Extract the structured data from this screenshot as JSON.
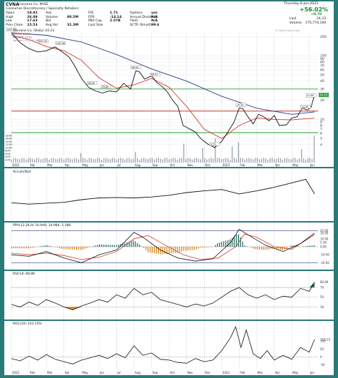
{
  "header": {
    "ticker": "CVNA",
    "company": "Carvana Co. NYSE",
    "sector": "Consumer Discretionary / Specialty Retailers",
    "stats": [
      {
        "label": "Open",
        "value": "18.82"
      },
      {
        "label": "High",
        "value": "26.09"
      },
      {
        "label": "Low",
        "value": "17.63"
      },
      {
        "label": "Prev Close",
        "value": "15.53"
      },
      {
        "label": "Ask",
        "value": ""
      },
      {
        "label": "Volume",
        "value": "80.5M"
      },
      {
        "label": "Bid",
        "value": ""
      },
      {
        "label": "Avg Vol",
        "value": "31.3M"
      },
      {
        "label": "P/E",
        "value": "1.71"
      },
      {
        "label": "EPS",
        "value": "-14.14"
      },
      {
        "label": "Mkt Cap",
        "value": "2.57B"
      },
      {
        "label": "Last Size",
        "value": ""
      },
      {
        "label": "Options",
        "value": "yes"
      },
      {
        "label": "Annual Dividend",
        "value": "N/A"
      },
      {
        "label": "Yield",
        "value": "N/A"
      },
      {
        "label": "SCTR (Small)",
        "value": "99.6"
      }
    ],
    "date": "Thursday 8-Jun-2023",
    "pct_change": "+56.02%",
    "change": "+8.70",
    "last_label": "Last",
    "last": "24.23",
    "volume_label": "Volume",
    "volume_total": "175,774,160",
    "watermark": "© StockCharts.com"
  },
  "chart_data": [
    {
      "type": "line",
      "title": "Carvana Co. (Daily) 24.23",
      "legend": [
        "MA(50) 10.47",
        "MA(200) 13.11",
        "Volume 175,774,160"
      ],
      "x_ticks": [
        "2022",
        "Feb",
        "Mar",
        "Apr",
        "May",
        "Jun",
        "Jul",
        "Aug",
        "Sep",
        "Oct",
        "Nov",
        "Dec",
        "2023",
        "Feb",
        "Mar",
        "Apr",
        "May",
        "Jun"
      ],
      "y_ticks": [
        4,
        5,
        6,
        7,
        8,
        9,
        10,
        20,
        30,
        40,
        50,
        60,
        70,
        80,
        90,
        100,
        200
      ],
      "ylim": [
        3.5,
        230
      ],
      "log_scale": true,
      "price": [
        {
          "m": 0.0,
          "v": 230
        },
        {
          "m": 0.5,
          "v": 160
        },
        {
          "m": 1.0,
          "v": 130
        },
        {
          "m": 1.5,
          "v": 115
        },
        {
          "m": 2.0,
          "v": 120
        },
        {
          "m": 2.5,
          "v": 138
        },
        {
          "m": 3.0,
          "v": 110
        },
        {
          "m": 3.3,
          "v": 95
        },
        {
          "m": 3.6,
          "v": 70
        },
        {
          "m": 4.0,
          "v": 44
        },
        {
          "m": 4.4,
          "v": 32
        },
        {
          "m": 4.8,
          "v": 28
        },
        {
          "m": 5.2,
          "v": 26
        },
        {
          "m": 5.6,
          "v": 28
        },
        {
          "m": 6.0,
          "v": 27
        },
        {
          "m": 6.4,
          "v": 37
        },
        {
          "m": 6.8,
          "v": 30
        },
        {
          "m": 7.1,
          "v": 58
        },
        {
          "m": 7.3,
          "v": 56
        },
        {
          "m": 7.6,
          "v": 43
        },
        {
          "m": 8.0,
          "v": 48
        },
        {
          "m": 8.3,
          "v": 38
        },
        {
          "m": 8.6,
          "v": 33
        },
        {
          "m": 8.9,
          "v": 27
        },
        {
          "m": 9.2,
          "v": 20
        },
        {
          "m": 9.5,
          "v": 16
        },
        {
          "m": 9.8,
          "v": 8
        },
        {
          "m": 10.2,
          "v": 7
        },
        {
          "m": 10.5,
          "v": 6.3
        },
        {
          "m": 10.8,
          "v": 5
        },
        {
          "m": 11.2,
          "v": 4.1
        },
        {
          "m": 11.6,
          "v": 3.6
        },
        {
          "m": 12.0,
          "v": 4.5
        },
        {
          "m": 12.3,
          "v": 6
        },
        {
          "m": 12.7,
          "v": 9
        },
        {
          "m": 13.0,
          "v": 15
        },
        {
          "m": 13.2,
          "v": 14.8
        },
        {
          "m": 13.5,
          "v": 11
        },
        {
          "m": 13.8,
          "v": 8.5
        },
        {
          "m": 14.1,
          "v": 12
        },
        {
          "m": 14.4,
          "v": 11
        },
        {
          "m": 14.7,
          "v": 9.5
        },
        {
          "m": 15.0,
          "v": 11.5
        },
        {
          "m": 15.3,
          "v": 8
        },
        {
          "m": 15.7,
          "v": 8.2
        },
        {
          "m": 16.0,
          "v": 10.5
        },
        {
          "m": 16.3,
          "v": 11
        },
        {
          "m": 16.6,
          "v": 15
        },
        {
          "m": 16.9,
          "v": 14
        },
        {
          "m": 17.1,
          "v": 15.5
        },
        {
          "m": 17.3,
          "v": 24.23
        }
      ],
      "ma50": [
        {
          "m": 0.0,
          "v": 210
        },
        {
          "m": 1.0,
          "v": 180
        },
        {
          "m": 2.0,
          "v": 140
        },
        {
          "m": 3.0,
          "v": 120
        },
        {
          "m": 4.0,
          "v": 85
        },
        {
          "m": 5.0,
          "v": 45
        },
        {
          "m": 6.0,
          "v": 31
        },
        {
          "m": 7.0,
          "v": 35
        },
        {
          "m": 8.0,
          "v": 44
        },
        {
          "m": 9.0,
          "v": 32
        },
        {
          "m": 10.0,
          "v": 16
        },
        {
          "m": 11.0,
          "v": 7
        },
        {
          "m": 12.0,
          "v": 5
        },
        {
          "m": 13.0,
          "v": 8
        },
        {
          "m": 14.0,
          "v": 10.5
        },
        {
          "m": 15.0,
          "v": 10
        },
        {
          "m": 16.0,
          "v": 9.8
        },
        {
          "m": 17.3,
          "v": 10.47
        }
      ],
      "ma200": [
        {
          "m": 0.0,
          "v": 230
        },
        {
          "m": 2.0,
          "v": 210
        },
        {
          "m": 4.0,
          "v": 165
        },
        {
          "m": 6.0,
          "v": 105
        },
        {
          "m": 8.0,
          "v": 62
        },
        {
          "m": 10.0,
          "v": 40
        },
        {
          "m": 12.0,
          "v": 23
        },
        {
          "m": 14.0,
          "v": 15
        },
        {
          "m": 16.0,
          "v": 12
        },
        {
          "m": 17.3,
          "v": 13.11
        }
      ],
      "price_labels": [
        {
          "m": 0.0,
          "v": 230,
          "t": "234.78"
        },
        {
          "m": 1.8,
          "v": 150,
          "t": "165.00"
        },
        {
          "m": 2.8,
          "v": 140,
          "t": "142.56"
        },
        {
          "m": 4.6,
          "v": 33,
          "t": "26.69"
        },
        {
          "m": 5.4,
          "v": 29,
          "t": "25.80"
        },
        {
          "m": 7.1,
          "v": 58,
          "t": "58.05"
        },
        {
          "m": 8.2,
          "v": 45,
          "t": "48.51"
        },
        {
          "m": 11.6,
          "v": 3.6,
          "t": "3.55"
        },
        {
          "m": 13.1,
          "v": 15,
          "t": "15.30"
        },
        {
          "m": 16.8,
          "v": 14,
          "t": "14.35"
        },
        {
          "m": 17.1,
          "v": 21,
          "t": "21.60"
        }
      ],
      "hlines": [
        {
          "v": 30,
          "color": "#2a9d3a"
        },
        {
          "v": 13.5,
          "color": "#c0392b"
        },
        {
          "v": 6.2,
          "color": "#2a9d3a"
        }
      ],
      "volume_ticks": [
        "20M",
        "40M",
        "60M",
        "80M",
        "100M",
        "120M",
        "140M",
        "160M",
        "180M"
      ],
      "volume_spikes": [
        {
          "m": 4.0,
          "h": 0.35
        },
        {
          "m": 7.1,
          "h": 0.4
        },
        {
          "m": 9.8,
          "h": 0.7
        },
        {
          "m": 10.9,
          "h": 0.55
        },
        {
          "m": 11.6,
          "h": 0.9
        },
        {
          "m": 12.6,
          "h": 0.6
        },
        {
          "m": 13.0,
          "h": 0.75
        },
        {
          "m": 16.6,
          "h": 0.5
        },
        {
          "m": 17.3,
          "h": 1.0
        }
      ],
      "grid": true
    },
    {
      "type": "line",
      "title": "Accum/Dist",
      "values": [
        {
          "m": 0,
          "v": 0.35
        },
        {
          "m": 1,
          "v": 0.32
        },
        {
          "m": 2,
          "v": 0.34
        },
        {
          "m": 3,
          "v": 0.36
        },
        {
          "m": 4,
          "v": 0.42
        },
        {
          "m": 5,
          "v": 0.46
        },
        {
          "m": 6,
          "v": 0.47
        },
        {
          "m": 7,
          "v": 0.46
        },
        {
          "m": 8,
          "v": 0.48
        },
        {
          "m": 9,
          "v": 0.52
        },
        {
          "m": 10,
          "v": 0.58
        },
        {
          "m": 11,
          "v": 0.62
        },
        {
          "m": 12,
          "v": 0.65
        },
        {
          "m": 13,
          "v": 0.55
        },
        {
          "m": 14,
          "v": 0.62
        },
        {
          "m": 15,
          "v": 0.7
        },
        {
          "m": 16,
          "v": 0.8
        },
        {
          "m": 16.8,
          "v": 0.88
        },
        {
          "m": 17.3,
          "v": 0.55
        }
      ]
    },
    {
      "type": "line",
      "title": "PPO(12,26,9) 16.949, 14.984, 5.386",
      "right_ticks": [
        "20.00",
        "16.95",
        "10.00",
        "5.39",
        "0.00",
        "-10.00",
        "-20.00"
      ],
      "ylim": [
        -25,
        25
      ],
      "ppo": [
        {
          "m": 0,
          "v": -10
        },
        {
          "m": 1,
          "v": -12
        },
        {
          "m": 2,
          "v": -6
        },
        {
          "m": 3,
          "v": -14
        },
        {
          "m": 4,
          "v": -20
        },
        {
          "m": 5,
          "v": -10
        },
        {
          "m": 6,
          "v": -4
        },
        {
          "m": 7,
          "v": 18
        },
        {
          "m": 7.5,
          "v": 12
        },
        {
          "m": 8.5,
          "v": -4
        },
        {
          "m": 9.5,
          "v": -14
        },
        {
          "m": 10.5,
          "v": -18
        },
        {
          "m": 11.5,
          "v": -15
        },
        {
          "m": 12.5,
          "v": 5
        },
        {
          "m": 13.0,
          "v": 22
        },
        {
          "m": 13.5,
          "v": 15
        },
        {
          "m": 14.5,
          "v": 2
        },
        {
          "m": 15.5,
          "v": -6
        },
        {
          "m": 16.5,
          "v": 4
        },
        {
          "m": 17.3,
          "v": 16.95
        }
      ],
      "signal": [
        {
          "m": 0,
          "v": -8
        },
        {
          "m": 1,
          "v": -10
        },
        {
          "m": 2,
          "v": -8
        },
        {
          "m": 3,
          "v": -11
        },
        {
          "m": 4,
          "v": -16
        },
        {
          "m": 5,
          "v": -13
        },
        {
          "m": 6,
          "v": -6
        },
        {
          "m": 7,
          "v": 10
        },
        {
          "m": 7.8,
          "v": 14
        },
        {
          "m": 8.8,
          "v": 2
        },
        {
          "m": 9.8,
          "v": -10
        },
        {
          "m": 10.8,
          "v": -16
        },
        {
          "m": 11.8,
          "v": -14
        },
        {
          "m": 12.8,
          "v": 0
        },
        {
          "m": 13.3,
          "v": 16
        },
        {
          "m": 14.0,
          "v": 12
        },
        {
          "m": 15.0,
          "v": 0
        },
        {
          "m": 16.0,
          "v": -3
        },
        {
          "m": 17.3,
          "v": 14.98
        }
      ],
      "hist_label": "5.386"
    },
    {
      "type": "line",
      "title": "RSI(14) 80.86",
      "right_ticks": [
        "80.86",
        "70",
        "50",
        "30"
      ],
      "ylim": [
        10,
        95
      ],
      "values": [
        {
          "m": 0,
          "v": 35
        },
        {
          "m": 0.5,
          "v": 30
        },
        {
          "m": 1,
          "v": 40
        },
        {
          "m": 1.5,
          "v": 33
        },
        {
          "m": 2,
          "v": 45
        },
        {
          "m": 2.5,
          "v": 38
        },
        {
          "m": 3,
          "v": 30
        },
        {
          "m": 3.5,
          "v": 24
        },
        {
          "m": 4,
          "v": 32
        },
        {
          "m": 4.5,
          "v": 38
        },
        {
          "m": 5,
          "v": 45
        },
        {
          "m": 5.5,
          "v": 40
        },
        {
          "m": 6,
          "v": 55
        },
        {
          "m": 6.5,
          "v": 48
        },
        {
          "m": 7,
          "v": 68
        },
        {
          "m": 7.5,
          "v": 55
        },
        {
          "m": 8,
          "v": 60
        },
        {
          "m": 8.5,
          "v": 45
        },
        {
          "m": 9,
          "v": 40
        },
        {
          "m": 9.5,
          "v": 35
        },
        {
          "m": 10,
          "v": 30
        },
        {
          "m": 10.5,
          "v": 36
        },
        {
          "m": 11,
          "v": 32
        },
        {
          "m": 11.5,
          "v": 38
        },
        {
          "m": 12,
          "v": 50
        },
        {
          "m": 12.5,
          "v": 62
        },
        {
          "m": 13,
          "v": 70
        },
        {
          "m": 13.5,
          "v": 55
        },
        {
          "m": 14,
          "v": 48
        },
        {
          "m": 14.5,
          "v": 55
        },
        {
          "m": 15,
          "v": 45
        },
        {
          "m": 15.5,
          "v": 52
        },
        {
          "m": 16,
          "v": 50
        },
        {
          "m": 16.5,
          "v": 68
        },
        {
          "m": 17,
          "v": 62
        },
        {
          "m": 17.3,
          "v": 80.86
        }
      ]
    },
    {
      "type": "line",
      "title": "ROC(10) 110.15%",
      "right_ticks": [
        "110.15",
        "100",
        "50",
        "0",
        "-50"
      ],
      "ylim": [
        -70,
        200
      ],
      "values": [
        {
          "m": 0,
          "v": -10
        },
        {
          "m": 0.5,
          "v": -25
        },
        {
          "m": 1,
          "v": 5
        },
        {
          "m": 1.5,
          "v": -20
        },
        {
          "m": 2,
          "v": 15
        },
        {
          "m": 2.5,
          "v": -15
        },
        {
          "m": 3,
          "v": -30
        },
        {
          "m": 3.5,
          "v": -45
        },
        {
          "m": 4,
          "v": -20
        },
        {
          "m": 4.5,
          "v": -5
        },
        {
          "m": 5,
          "v": 10
        },
        {
          "m": 5.5,
          "v": -10
        },
        {
          "m": 6,
          "v": 20
        },
        {
          "m": 6.5,
          "v": -5
        },
        {
          "m": 7,
          "v": 70
        },
        {
          "m": 7.5,
          "v": 10
        },
        {
          "m": 8,
          "v": 25
        },
        {
          "m": 8.5,
          "v": -15
        },
        {
          "m": 9,
          "v": -20
        },
        {
          "m": 9.5,
          "v": -35
        },
        {
          "m": 10,
          "v": -40
        },
        {
          "m": 10.5,
          "v": -10
        },
        {
          "m": 11,
          "v": -30
        },
        {
          "m": 11.5,
          "v": -20
        },
        {
          "m": 12,
          "v": 40
        },
        {
          "m": 12.5,
          "v": 120
        },
        {
          "m": 12.8,
          "v": 190
        },
        {
          "m": 13.1,
          "v": 60
        },
        {
          "m": 13.4,
          "v": 170
        },
        {
          "m": 13.8,
          "v": 20
        },
        {
          "m": 14.2,
          "v": -10
        },
        {
          "m": 14.6,
          "v": 40
        },
        {
          "m": 15,
          "v": -20
        },
        {
          "m": 15.5,
          "v": 10
        },
        {
          "m": 16,
          "v": -15
        },
        {
          "m": 16.5,
          "v": 60
        },
        {
          "m": 17,
          "v": 30
        },
        {
          "m": 17.3,
          "v": 110.15
        }
      ]
    }
  ]
}
